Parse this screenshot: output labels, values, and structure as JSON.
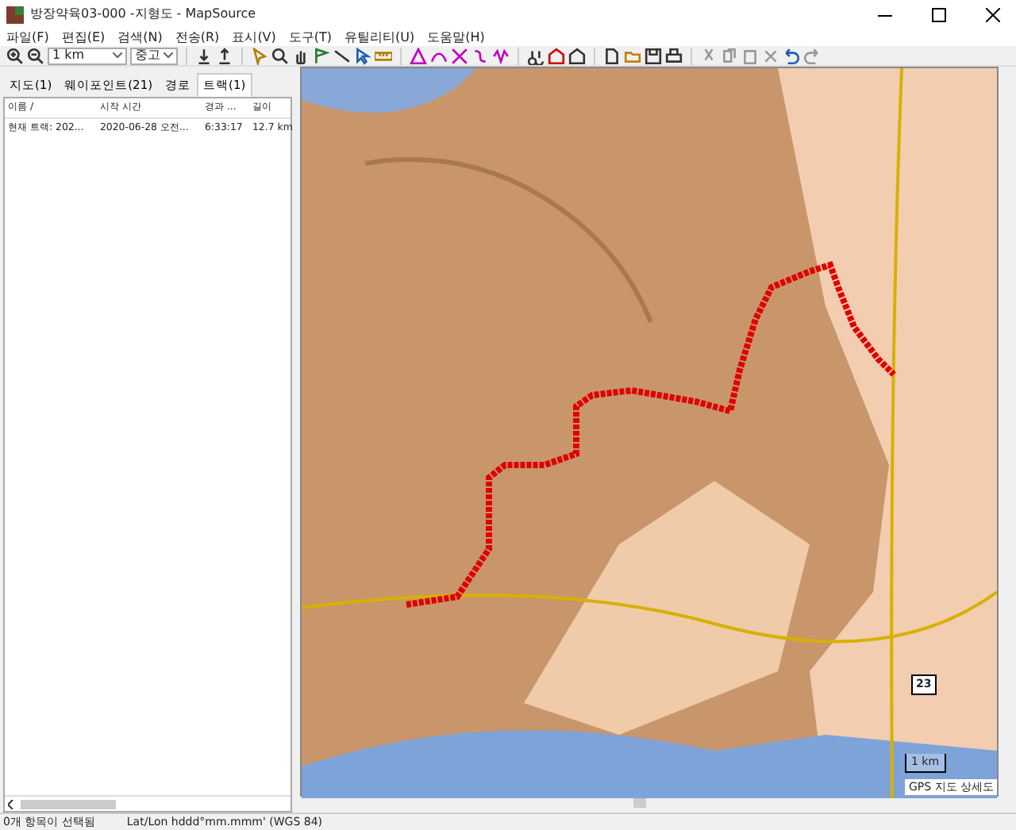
{
  "window": {
    "title": "방장약육03-000 -지형도 - MapSource"
  },
  "menu": [
    "파일(F)",
    "편집(E)",
    "검색(N)",
    "전송(R)",
    "표시(V)",
    "도구(T)",
    "유틸리티(U)",
    "도움말(H)"
  ],
  "toolbar": {
    "scale": "1 km",
    "detail": "중고"
  },
  "tabs": [
    {
      "label": "지도(1)",
      "selected": false
    },
    {
      "label": "웨이포인트(21)",
      "selected": false
    },
    {
      "label": "경로",
      "selected": false
    },
    {
      "label": "트랙(1)",
      "selected": true
    }
  ],
  "table": {
    "columns": [
      "이름 /",
      "시작 시간",
      "경과 ...",
      "길이"
    ],
    "rows": [
      {
        "cells": [
          "현재 트랙: 202...",
          "2020-06-28 오전...",
          "6:33:17",
          "12.7 km"
        ],
        "selected": false
      }
    ]
  },
  "map": {
    "route_shield": "23",
    "scale_label": "1 km",
    "copyright": "GPS 지도 상세도"
  },
  "status_bar": [
    "0개 항목이 선택됨",
    "Lat/Lon hddd°mm.mmm' (WGS 84)"
  ]
}
